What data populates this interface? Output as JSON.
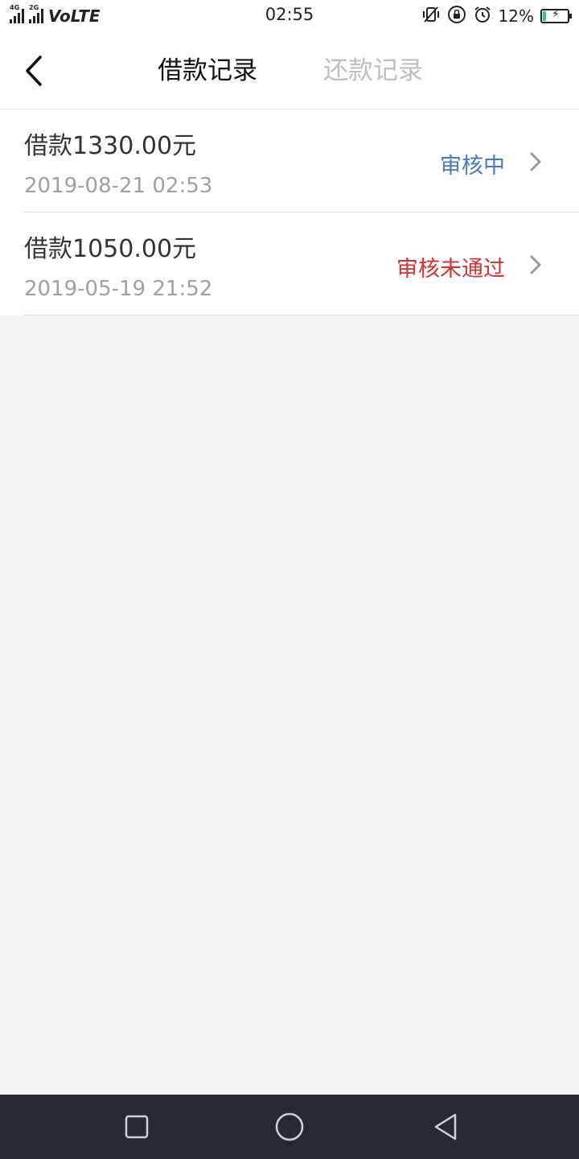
{
  "status_bar": {
    "signal1_label": "4G",
    "signal2_label": "2G",
    "volte": "VoLTE",
    "time": "02:55",
    "battery_percent": "12%",
    "battery_level": 0.12,
    "battery_color": "#2ecc71"
  },
  "header": {
    "back_icon": "chevron-left-icon",
    "tabs": [
      {
        "label": "借款记录",
        "active": true
      },
      {
        "label": "还款记录",
        "active": false
      }
    ]
  },
  "records": [
    {
      "amount": "借款1330.00元",
      "datetime": "2019-08-21 02:53",
      "status": "审核中",
      "status_color": "#4a78c8"
    },
    {
      "amount": "借款1050.00元",
      "datetime": "2019-05-19 21:52",
      "status": "审核未通过",
      "status_color": "#d93030"
    }
  ],
  "nav_bar": {
    "buttons": [
      "recent-apps-icon",
      "home-icon",
      "back-icon"
    ],
    "background": "#252a33"
  }
}
